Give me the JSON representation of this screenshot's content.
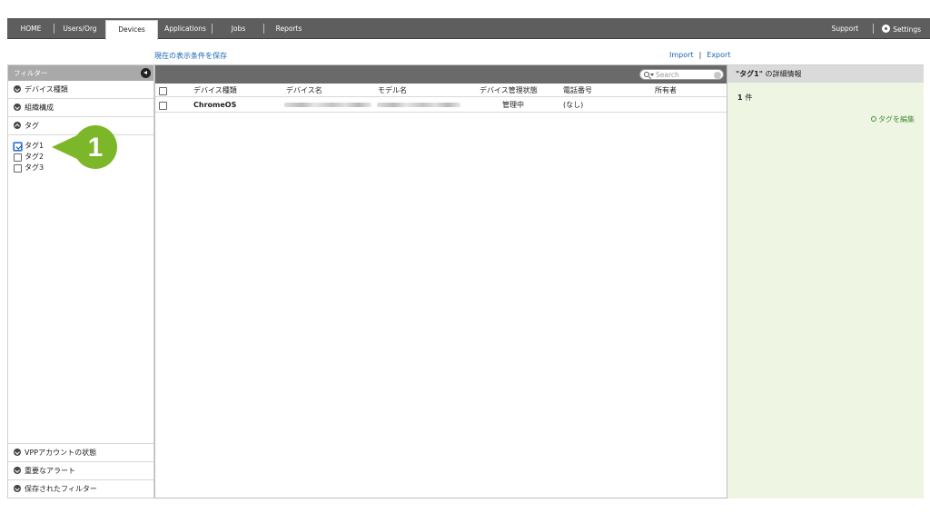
{
  "nav": {
    "items": [
      "HOME",
      "Users/Org",
      "Devices",
      "Applications",
      "Jobs",
      "Reports"
    ],
    "active": "Devices",
    "support": "Support",
    "settings": "Settings"
  },
  "links": {
    "save_view": "現在の表示条件を保存",
    "import": "Import",
    "separator": "|",
    "export": "Export"
  },
  "sidebar": {
    "header": "フィルター",
    "sections_top": [
      "デバイス種類",
      "組織構成",
      "タグ"
    ],
    "tags": [
      {
        "label": "タグ1",
        "checked": true
      },
      {
        "label": "タグ2",
        "checked": false
      },
      {
        "label": "タグ3",
        "checked": false
      }
    ],
    "sections_bottom": [
      "VPPアカウントの状態",
      "重要なアラート",
      "保存されたフィルター"
    ]
  },
  "callout": {
    "number": "1",
    "color": "#7cb629"
  },
  "table": {
    "search_placeholder": "Search",
    "columns": [
      "デバイス種類",
      "デバイス名",
      "モデル名",
      "デバイス管理状態",
      "電話番号",
      "所有者"
    ],
    "rows": [
      {
        "type": "ChromeOS",
        "name": "",
        "model": "",
        "status": "管理中",
        "phone": "(なし)",
        "owner": ""
      }
    ]
  },
  "detail": {
    "title_tag": "\"タグ1\"",
    "title_suffix": "の詳細情報",
    "count_num": "1",
    "count_unit": "件",
    "edit_tags": "タグを編集",
    "bg_color": "#eef6e3"
  }
}
